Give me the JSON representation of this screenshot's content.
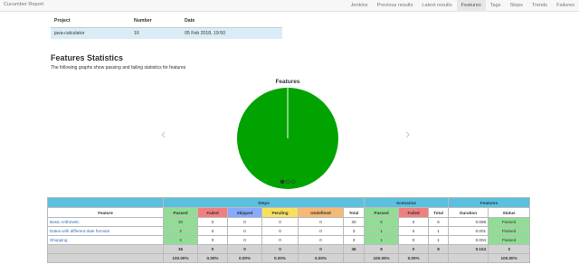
{
  "app": {
    "brand": "Cucumber Report"
  },
  "nav": {
    "items": [
      {
        "label": "Jenkins"
      },
      {
        "label": "Previous results"
      },
      {
        "label": "Latest results"
      },
      {
        "label": "Features"
      },
      {
        "label": "Tags"
      },
      {
        "label": "Steps"
      },
      {
        "label": "Trends"
      },
      {
        "label": "Failures"
      }
    ],
    "active": "Features"
  },
  "project_table": {
    "headers": [
      "Project",
      "Number",
      "Date"
    ],
    "row": [
      "java-calculator",
      "16",
      "05 Feb 2018, 19:50"
    ]
  },
  "page": {
    "title": "Features Statistics",
    "subtitle": "The following graphs show passing and failing statistics for features"
  },
  "chart_data": {
    "type": "pie",
    "title": "Features",
    "categories": [
      "Passed",
      "Failed",
      "Skipped",
      "Pending",
      "Undefined"
    ],
    "values": [
      3,
      0,
      0,
      0,
      0
    ],
    "colors": {
      "passed": "#00a300",
      "separator": "#ffffff"
    }
  },
  "carousel": {
    "prev_glyph": "‹",
    "next_glyph": "›",
    "indicators": [
      true,
      false,
      false
    ]
  },
  "stats": {
    "group_headers": {
      "steps": "Steps",
      "scenarios": "Scenarios",
      "features": "Features"
    },
    "columns": [
      "Feature",
      "Passed",
      "Failed",
      "Skipped",
      "Pending",
      "Undefined",
      "Total",
      "Passed",
      "Failed",
      "Total",
      "Duration",
      "Status"
    ],
    "rows": [
      [
        "Basic Arithmetic",
        "30",
        "0",
        "0",
        "0",
        "0",
        "30",
        "6",
        "0",
        "6",
        "0.099",
        "Passed"
      ],
      [
        "Dates with different date formats",
        "3",
        "0",
        "0",
        "0",
        "0",
        "3",
        "1",
        "0",
        "1",
        "0.001",
        "Passed"
      ],
      [
        "Shopping",
        "3",
        "0",
        "0",
        "0",
        "0",
        "3",
        "1",
        "0",
        "1",
        "0.004",
        "Passed"
      ]
    ],
    "totals": [
      "",
      "36",
      "0",
      "0",
      "0",
      "0",
      "36",
      "8",
      "0",
      "8",
      "0.104",
      "3"
    ],
    "percents": [
      "",
      "100.00%",
      "0.00%",
      "0.00%",
      "0.00%",
      "0.00%",
      "",
      "100.00%",
      "0.00%",
      "",
      "",
      "100.00%"
    ]
  }
}
